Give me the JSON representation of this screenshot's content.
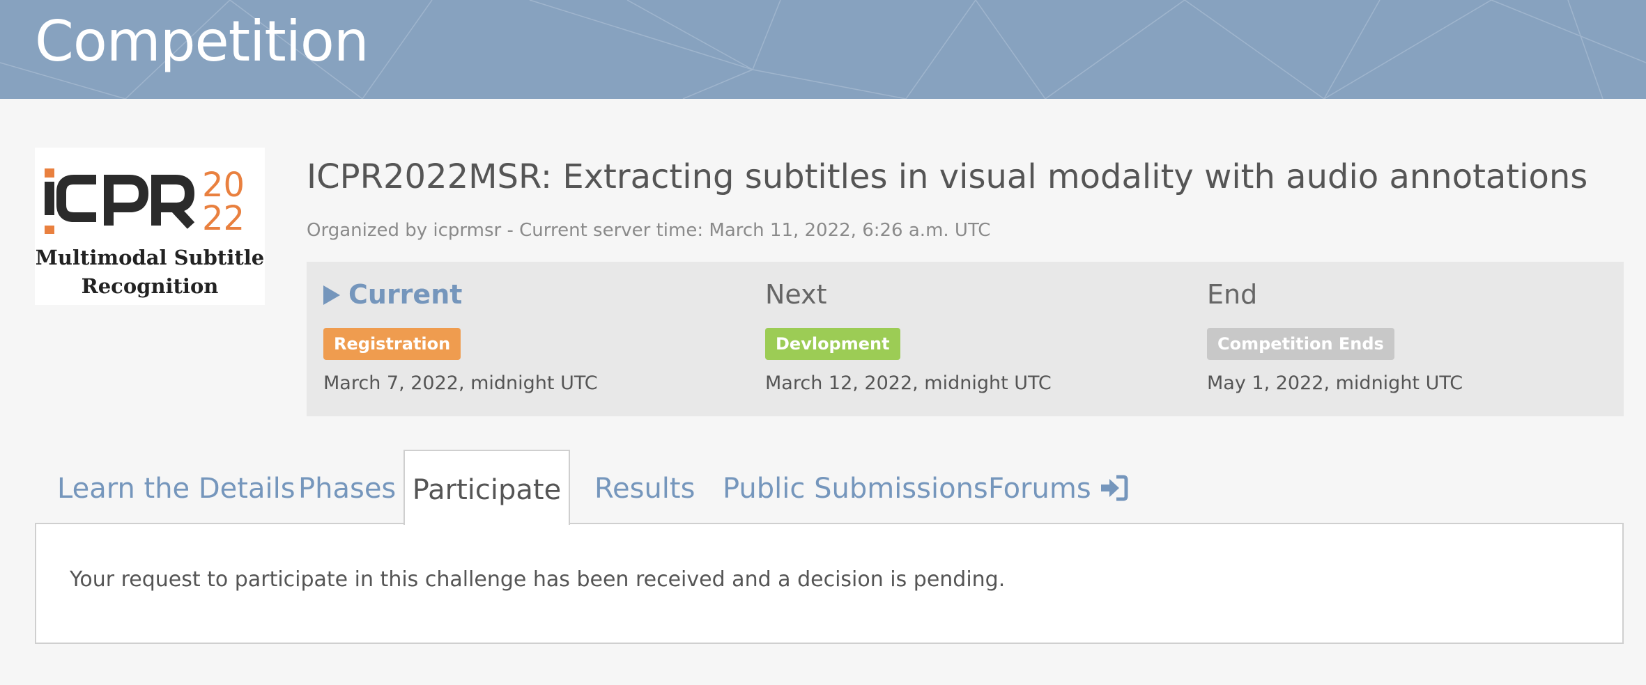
{
  "banner": {
    "title": "Competition"
  },
  "logo": {
    "mark_year_top": "20",
    "mark_year_bottom": "22",
    "caption_line1": "Multimodal Subtitle",
    "caption_line2": "Recognition"
  },
  "competition": {
    "title": "ICPR2022MSR: Extracting subtitles in visual modality with audio annotations",
    "organizer_line": "Organized by icprmsr - Current server time: March 11, 2022, 6:26 a.m. UTC"
  },
  "phases": [
    {
      "heading": "Current",
      "badge": "Registration",
      "badge_color": "#ef9c4f",
      "date": "March 7, 2022, midnight UTC",
      "is_current": true
    },
    {
      "heading": "Next",
      "badge": "Devlopment",
      "badge_color": "#9ccc55",
      "date": "March 12, 2022, midnight UTC",
      "is_current": false
    },
    {
      "heading": "End",
      "badge": "Competition Ends",
      "badge_color": "#c8c8c8",
      "date": "May 1, 2022, midnight UTC",
      "is_current": false
    }
  ],
  "tabs": [
    {
      "label": "Learn the Details",
      "active": false
    },
    {
      "label": "Phases",
      "active": false
    },
    {
      "label": "Participate",
      "active": true
    },
    {
      "label": "Results",
      "active": false
    },
    {
      "label": "Public Submissions",
      "active": false
    },
    {
      "label": "Forums",
      "active": false,
      "icon": "sign-in-icon"
    }
  ],
  "participate": {
    "message": "Your request to participate in this challenge has been received and a decision is pending."
  },
  "colors": {
    "banner": "#87a2bf",
    "link": "#7596bc",
    "logo_orange": "#e9803f",
    "logo_dark": "#2b2b2b"
  }
}
